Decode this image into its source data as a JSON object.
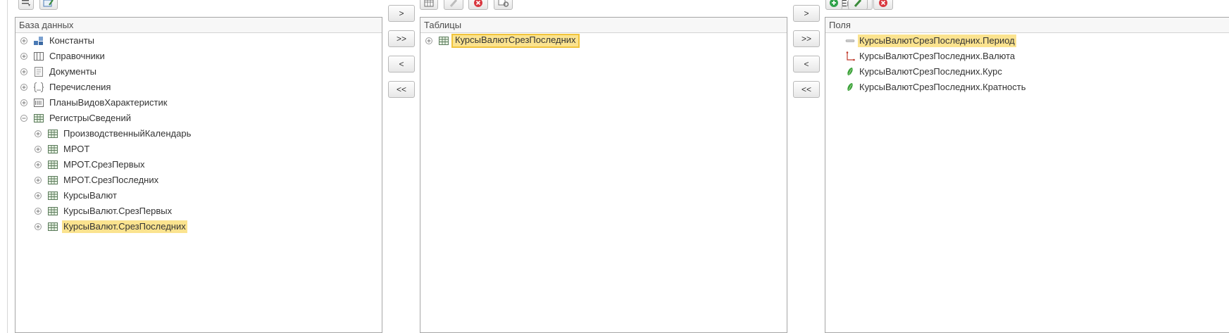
{
  "db_panel": {
    "header": "База данных",
    "items": [
      {
        "label": "Константы",
        "icon": "constants-icon"
      },
      {
        "label": "Справочники",
        "icon": "catalogs-icon"
      },
      {
        "label": "Документы",
        "icon": "documents-icon"
      },
      {
        "label": "Перечисления",
        "icon": "enums-icon"
      },
      {
        "label": "ПланыВидовХарактеристик",
        "icon": "chart-of-characteristics-icon"
      },
      {
        "label": "РегистрыСведений",
        "icon": "information-registers-icon"
      }
    ],
    "children": [
      {
        "label": "ПроизводственныйКалендарь"
      },
      {
        "label": "МРОТ"
      },
      {
        "label": "МРОТ.СрезПервых"
      },
      {
        "label": "МРОТ.СрезПоследних"
      },
      {
        "label": "КурсыВалют"
      },
      {
        "label": "КурсыВалют.СрезПервых"
      },
      {
        "label": "КурсыВалют.СрезПоследних"
      }
    ]
  },
  "tables_panel": {
    "header": "Таблицы",
    "items": [
      {
        "label": "КурсыВалютСрезПоследних"
      }
    ]
  },
  "fields_panel": {
    "header": "Поля",
    "items": [
      {
        "label": "КурсыВалютСрезПоследних.Период",
        "icon": "period-field-icon"
      },
      {
        "label": "КурсыВалютСрезПоследних.Валюта",
        "icon": "reference-field-icon"
      },
      {
        "label": "КурсыВалютСрезПоследних.Курс",
        "icon": "resource-field-icon"
      },
      {
        "label": "КурсыВалютСрезПоследних.Кратность",
        "icon": "resource-field-icon"
      }
    ]
  },
  "move_buttons_1": {
    "add": ">",
    "add_all": ">>",
    "remove": "<",
    "remove_all": "<<"
  },
  "move_buttons_2": {
    "add": ">",
    "add_all": ">>",
    "remove": "<",
    "remove_all": "<<"
  },
  "toolbar": {
    "more_label": "Еще"
  },
  "colors": {
    "selection": "#fbe38f",
    "selection_border": "#f0c33c",
    "border": "#a6a6a6"
  }
}
